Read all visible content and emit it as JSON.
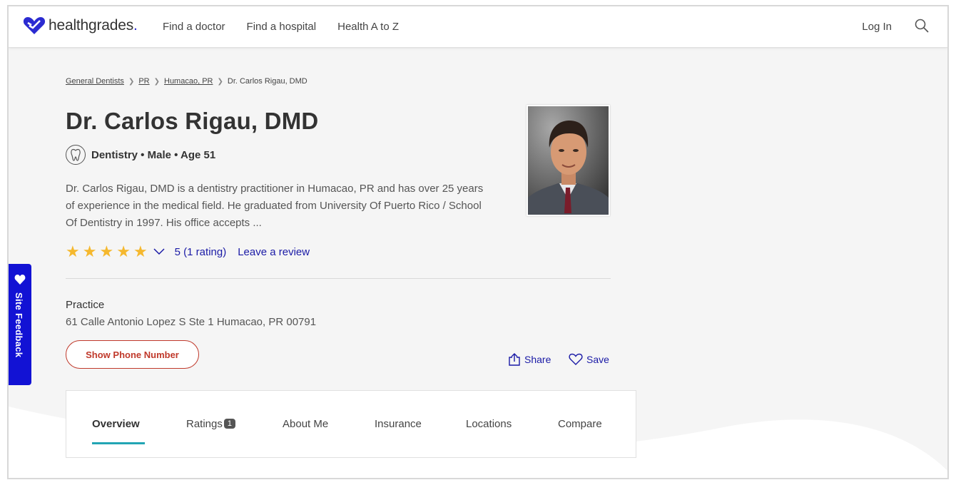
{
  "header": {
    "logo_text": "healthgrades",
    "logo_dot": ".",
    "nav": [
      "Find a doctor",
      "Find a hospital",
      "Health A to Z"
    ],
    "login": "Log In",
    "brand_color": "#2b2bd1"
  },
  "breadcrumb": [
    "General Dentists",
    "PR",
    "Humacao, PR",
    "Dr. Carlos Rigau, DMD"
  ],
  "doctor": {
    "name": "Dr. Carlos Rigau, DMD",
    "specialty_line": "Dentistry • Male • Age 51",
    "bio": "Dr. Carlos Rigau, DMD is a dentistry practitioner in Humacao, PR and has over 25 years of experience in the medical field. He graduated from University Of Puerto Rico / School Of Dentistry in 1997. His office accepts ...",
    "rating_stars": 5,
    "rating_text": "5 (1 rating)",
    "review_link": "Leave a review"
  },
  "practice": {
    "label": "Practice",
    "address": "61 Calle Antonio Lopez S Ste 1 Humacao, PR 00791"
  },
  "actions": {
    "phone": "Show Phone Number",
    "share": "Share",
    "save": "Save"
  },
  "tabs": {
    "overview": "Overview",
    "ratings": "Ratings",
    "ratings_count": "1",
    "about": "About Me",
    "insurance": "Insurance",
    "locations": "Locations",
    "compare": "Compare"
  },
  "feedback": "Site Feedback",
  "colors": {
    "accent": "#1a1aa6",
    "phone_button": "#c0392b",
    "tab_underline": "#22a5b4",
    "star": "#f5b82e"
  }
}
